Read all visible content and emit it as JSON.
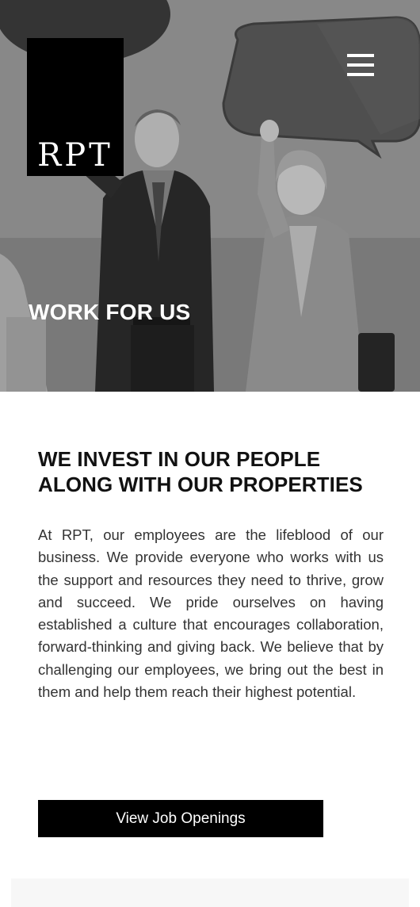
{
  "brand": {
    "logo_text": "RPT"
  },
  "hero": {
    "title": "WORK FOR US"
  },
  "main": {
    "heading": "WE INVEST IN OUR PEOPLE ALONG WITH OUR PROPERTIES",
    "body": "At RPT, our employees are the lifeblood of our business. We provide everyone who works with us the support and resources they need to thrive, grow and succeed. We pride ourselves on having established a culture that encourages collaboration, forward-thinking and giving back. We believe that by challenging our employees, we bring out the best in them and help them reach their highest potential.",
    "cta_label": "View Job Openings"
  },
  "icons": {
    "menu": "hamburger-menu-icon"
  },
  "colors": {
    "logo_bg": "#000000",
    "button_bg": "#000000",
    "button_text": "#ffffff",
    "hero_text": "#ffffff"
  }
}
